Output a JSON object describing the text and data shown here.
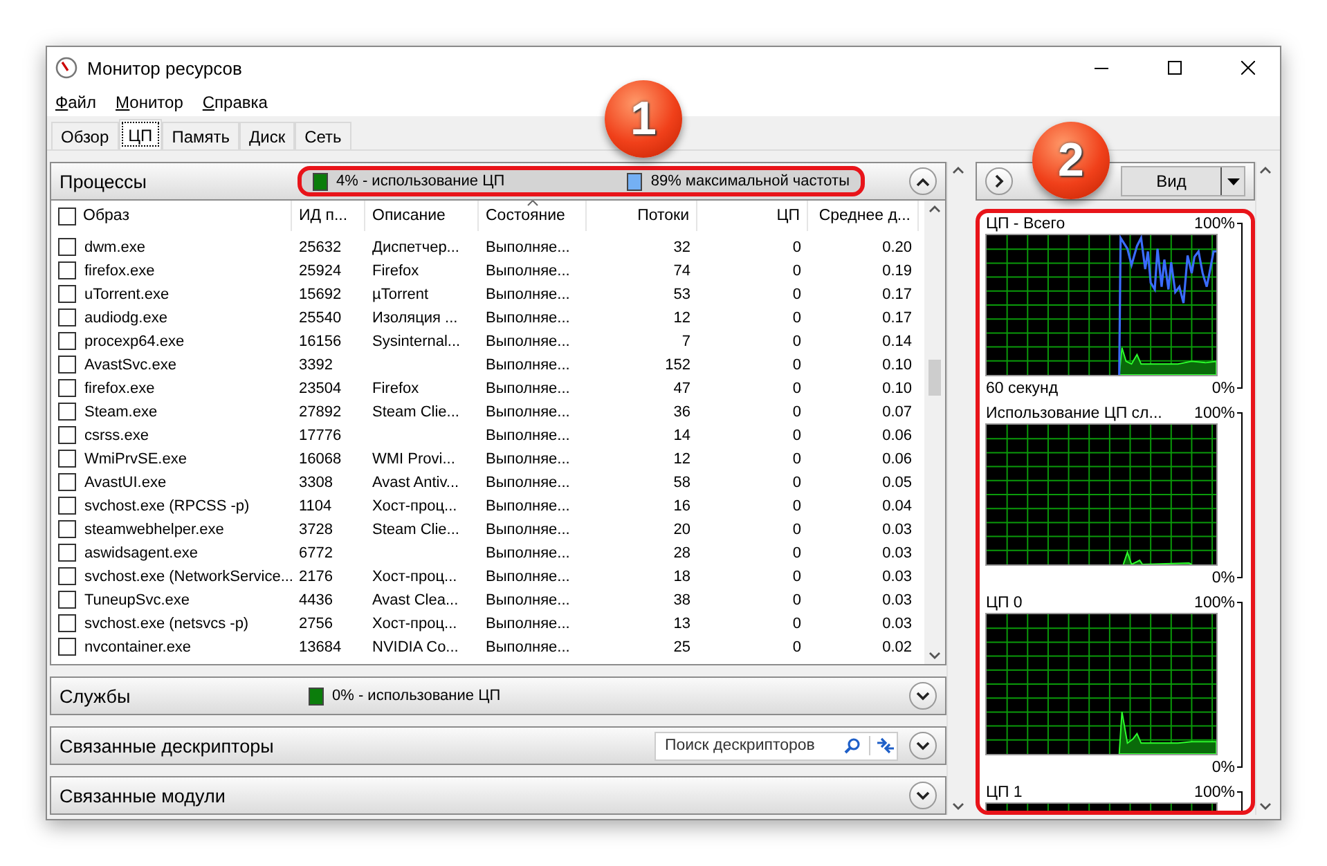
{
  "window": {
    "title": "Монитор ресурсов"
  },
  "menu": [
    {
      "label": "Файл"
    },
    {
      "label": "Монитор"
    },
    {
      "label": "Справка"
    }
  ],
  "tabs": [
    {
      "label": "Обзор",
      "selected": false
    },
    {
      "label": "ЦП",
      "selected": true
    },
    {
      "label": "Память",
      "selected": false
    },
    {
      "label": "Диск",
      "selected": false
    },
    {
      "label": "Сеть",
      "selected": false
    }
  ],
  "processes": {
    "title": "Процессы",
    "expanded": true,
    "stats": [
      {
        "text": "4% - использование ЦП",
        "color": "#0b7d0b"
      },
      {
        "text": "89% максимальной частоты",
        "color": "#74b0f4"
      }
    ],
    "header_checkbox": {
      "checked": false
    },
    "columns": [
      {
        "label": "Образ",
        "sorted": false
      },
      {
        "label": "ИД п...",
        "sorted": false
      },
      {
        "label": "Описание",
        "sorted": false
      },
      {
        "label": "Состояние",
        "sorted": true
      },
      {
        "label": "Потоки",
        "sorted": false
      },
      {
        "label": "ЦП",
        "sorted": false
      },
      {
        "label": "Среднее д...",
        "sorted": false
      }
    ],
    "rows": [
      {
        "checked": false,
        "cells": [
          "dwm.exe",
          "25632",
          "Диспетчер...",
          "Выполняе...",
          "32",
          "0",
          "0.20"
        ]
      },
      {
        "checked": false,
        "cells": [
          "firefox.exe",
          "25924",
          "Firefox",
          "Выполняе...",
          "74",
          "0",
          "0.19"
        ]
      },
      {
        "checked": false,
        "cells": [
          "uTorrent.exe",
          "15692",
          "µTorrent",
          "Выполняе...",
          "53",
          "0",
          "0.17"
        ]
      },
      {
        "checked": false,
        "cells": [
          "audiodg.exe",
          "25540",
          "Изоляция ...",
          "Выполняе...",
          "12",
          "0",
          "0.17"
        ]
      },
      {
        "checked": false,
        "cells": [
          "procexp64.exe",
          "16156",
          "Sysinternal...",
          "Выполняе...",
          "7",
          "0",
          "0.14"
        ]
      },
      {
        "checked": false,
        "cells": [
          "AvastSvc.exe",
          "3392",
          "",
          "Выполняе...",
          "152",
          "0",
          "0.10"
        ]
      },
      {
        "checked": false,
        "cells": [
          "firefox.exe",
          "23504",
          "Firefox",
          "Выполняе...",
          "47",
          "0",
          "0.10"
        ]
      },
      {
        "checked": false,
        "cells": [
          "Steam.exe",
          "27892",
          "Steam Clie...",
          "Выполняе...",
          "36",
          "0",
          "0.07"
        ]
      },
      {
        "checked": false,
        "cells": [
          "csrss.exe",
          "17776",
          "",
          "Выполняе...",
          "14",
          "0",
          "0.06"
        ]
      },
      {
        "checked": false,
        "cells": [
          "WmiPrvSE.exe",
          "16068",
          "WMI Provi...",
          "Выполняе...",
          "12",
          "0",
          "0.06"
        ]
      },
      {
        "checked": false,
        "cells": [
          "AvastUI.exe",
          "3308",
          "Avast Antiv...",
          "Выполняе...",
          "58",
          "0",
          "0.05"
        ]
      },
      {
        "checked": false,
        "cells": [
          "svchost.exe (RPCSS -p)",
          "1104",
          "Хост-проц...",
          "Выполняе...",
          "16",
          "0",
          "0.04"
        ]
      },
      {
        "checked": false,
        "cells": [
          "steamwebhelper.exe",
          "3728",
          "Steam Clie...",
          "Выполняе...",
          "20",
          "0",
          "0.03"
        ]
      },
      {
        "checked": false,
        "cells": [
          "aswidsagent.exe",
          "6772",
          "",
          "Выполняе...",
          "28",
          "0",
          "0.03"
        ]
      },
      {
        "checked": false,
        "cells": [
          "svchost.exe (NetworkService...",
          "2176",
          "Хост-проц...",
          "Выполняе...",
          "18",
          "0",
          "0.03"
        ]
      },
      {
        "checked": false,
        "cells": [
          "TuneupSvc.exe",
          "4436",
          "Avast Clea...",
          "Выполняе...",
          "38",
          "0",
          "0.03"
        ]
      },
      {
        "checked": false,
        "cells": [
          "svchost.exe (netsvcs -p)",
          "2756",
          "Хост-проц...",
          "Выполняе...",
          "13",
          "0",
          "0.03"
        ]
      },
      {
        "checked": false,
        "cells": [
          "nvcontainer.exe",
          "13684",
          "NVIDIA Co...",
          "Выполняе...",
          "25",
          "0",
          "0.02"
        ]
      }
    ]
  },
  "services": {
    "title": "Службы",
    "expanded": false,
    "stats": [
      {
        "text": "0% - использование ЦП",
        "color": "#0b7d0b"
      }
    ]
  },
  "handles": {
    "title": "Связанные дескрипторы",
    "expanded": false,
    "search": {
      "placeholder": "Поиск дескрипторов"
    }
  },
  "modules": {
    "title": "Связанные модули",
    "expanded": false
  },
  "right_panel": {
    "view_button": "Вид",
    "graphs": [
      {
        "kind": "total",
        "title": "ЦП - Всего",
        "max": "100%",
        "time": "60 секунд",
        "min": "0%"
      },
      {
        "kind": "service",
        "title": "Использование ЦП сл...",
        "max": "100%",
        "min": "0%"
      },
      {
        "kind": "core",
        "title": "ЦП 0",
        "max": "100%",
        "min": "0%"
      },
      {
        "kind": "core",
        "title": "ЦП 1",
        "max": "100%"
      }
    ]
  },
  "annotations": [
    {
      "label": "1"
    },
    {
      "label": "2"
    }
  ]
}
